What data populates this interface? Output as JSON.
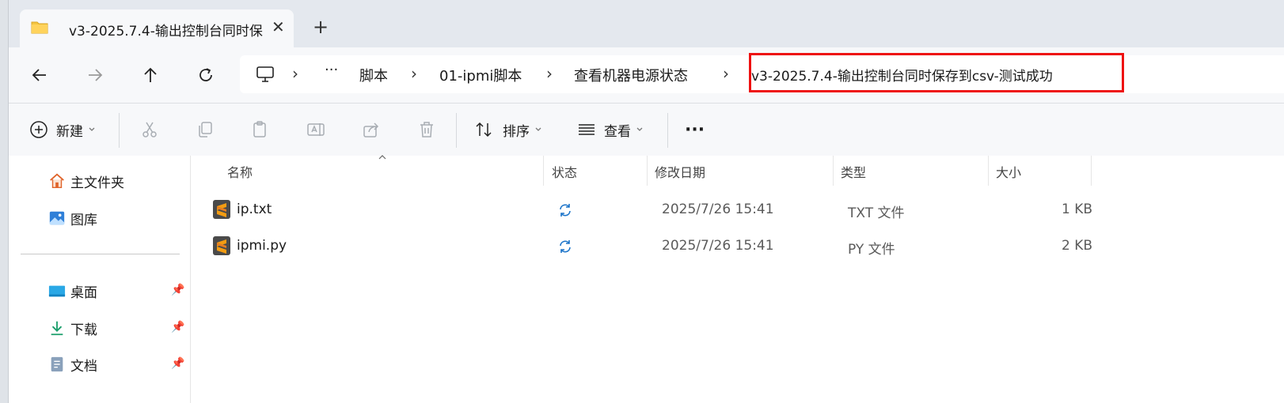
{
  "tab": {
    "title": "v3-2025.7.4-输出控制台同时保",
    "close": "✕",
    "new_tab": "+"
  },
  "nav": {
    "back": "←",
    "forward": "→",
    "up": "↑",
    "refresh": "↻"
  },
  "address": {
    "more": "···",
    "separator": "›",
    "crumbs": [
      "脚本",
      "01-ipmi脚本",
      "查看机器电源状态",
      "v3-2025.7.4-输出控制台同时保存到csv-测试成功"
    ]
  },
  "toolbar": {
    "new_label": "新建",
    "sort_label": "排序",
    "view_label": "查看",
    "more": "···"
  },
  "sidebar": {
    "items": [
      {
        "label": "主文件夹",
        "icon": "home-icon"
      },
      {
        "label": "图库",
        "icon": "gallery-icon"
      },
      {
        "label": "桌面",
        "icon": "desktop-icon",
        "pinned": true
      },
      {
        "label": "下载",
        "icon": "download-icon",
        "pinned": true
      },
      {
        "label": "文档",
        "icon": "documents-icon",
        "pinned": true
      }
    ]
  },
  "columns": {
    "name": "名称",
    "status": "状态",
    "modified": "修改日期",
    "type": "类型",
    "size": "大小"
  },
  "files": [
    {
      "name": "ip.txt",
      "modified": "2025/7/26 15:41",
      "type": "TXT 文件",
      "size": "1 KB"
    },
    {
      "name": "ipmi.py",
      "modified": "2025/7/26 15:41",
      "type": "PY 文件",
      "size": "2 KB"
    }
  ],
  "colors": {
    "highlight": "#ee1111",
    "sync": "#1a73c9",
    "sublime": "#f39c12"
  }
}
